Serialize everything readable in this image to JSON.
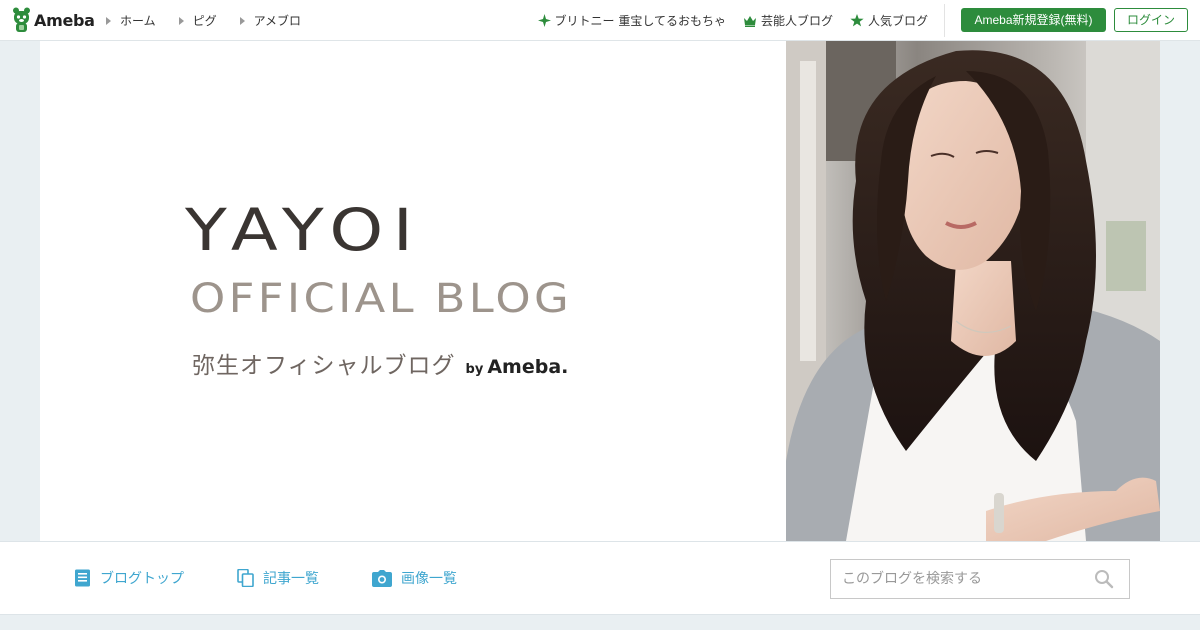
{
  "header": {
    "logo_text": "Ameba",
    "nav_left": [
      {
        "label": "ホーム"
      },
      {
        "label": "ピグ"
      },
      {
        "label": "アメブロ"
      }
    ],
    "nav_right": [
      {
        "label": "ブリトニー 重宝してるおもちゃ",
        "icon": "sparkle-icon"
      },
      {
        "label": "芸能人ブログ",
        "icon": "crown-icon"
      },
      {
        "label": "人気ブログ",
        "icon": "star-icon"
      }
    ],
    "register_label": "Ameba新規登録(無料)",
    "login_label": "ログイン",
    "accent_color": "#2d8c3c"
  },
  "hero": {
    "title_line1": "YAYOI",
    "title_line2": "OFFICIAL BLOG",
    "subtitle": "弥生オフィシャルブログ",
    "by": "by",
    "by_brand": "Ameba."
  },
  "blog_nav": {
    "items": [
      {
        "label": "ブログトップ",
        "icon": "document-icon"
      },
      {
        "label": "記事一覧",
        "icon": "copy-icon"
      },
      {
        "label": "画像一覧",
        "icon": "camera-icon"
      }
    ],
    "link_color": "#3fa6cf"
  },
  "search": {
    "placeholder": "このブログを検索する"
  }
}
